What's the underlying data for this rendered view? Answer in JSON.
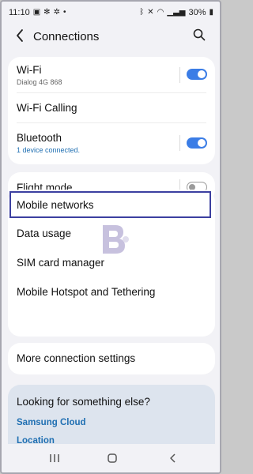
{
  "status_bar": {
    "time": "11:10",
    "battery": "30%"
  },
  "header": {
    "title": "Connections"
  },
  "card1": {
    "wifi": {
      "label": "Wi-Fi",
      "sub": "Dialog 4G 868",
      "toggle": "on"
    },
    "wifi_calling": {
      "label": "Wi-Fi Calling"
    },
    "bluetooth": {
      "label": "Bluetooth",
      "sub": "1 device connected.",
      "toggle": "on"
    }
  },
  "card2": {
    "flight_mode": {
      "label": "Flight mode",
      "toggle": "off"
    }
  },
  "card3": {
    "items": [
      {
        "label": "Mobile networks"
      },
      {
        "label": "Data usage"
      },
      {
        "label": "SIM card manager"
      },
      {
        "label": "Mobile Hotspot and Tethering"
      }
    ]
  },
  "card4": {
    "more": {
      "label": "More connection settings"
    }
  },
  "help": {
    "title": "Looking for something else?",
    "links": [
      "Samsung Cloud",
      "Location"
    ]
  },
  "colors": {
    "accent": "#3b7de6",
    "link": "#1f6fb2",
    "highlight_box": "#3c3fa0"
  }
}
